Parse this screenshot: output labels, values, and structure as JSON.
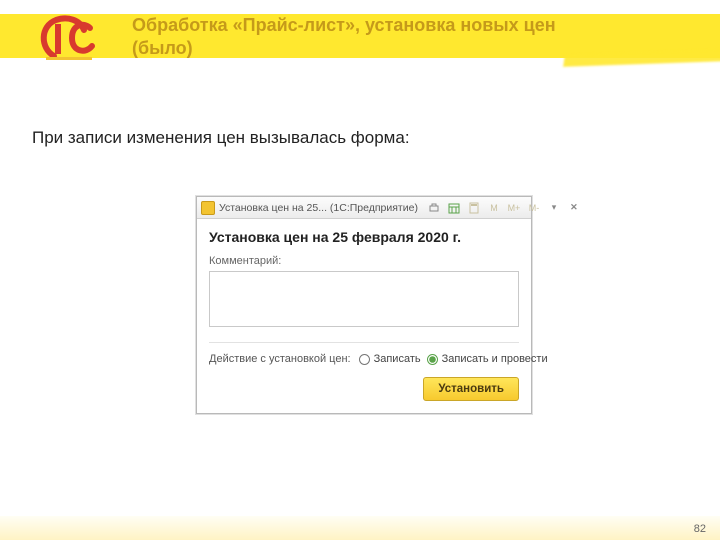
{
  "slide": {
    "title": "Обработка «Прайс-лист», установка новых цен (было)",
    "body_text": "При записи изменения цен вызывалась форма:",
    "page_number": "82"
  },
  "dialog": {
    "titlebar": {
      "text": "Установка цен на 25... (1С:Предприятие)"
    },
    "heading": "Установка цен на 25 февраля 2020 г.",
    "comment_label": "Комментарий:",
    "comment_value": "",
    "action_label": "Действие с установкой цен:",
    "radio1": "Записать",
    "radio2": "Записать и провести",
    "install_button": "Установить",
    "toolbar": {
      "m_label": "M",
      "mplus_label": "M+",
      "mminus_label": "M-"
    }
  }
}
